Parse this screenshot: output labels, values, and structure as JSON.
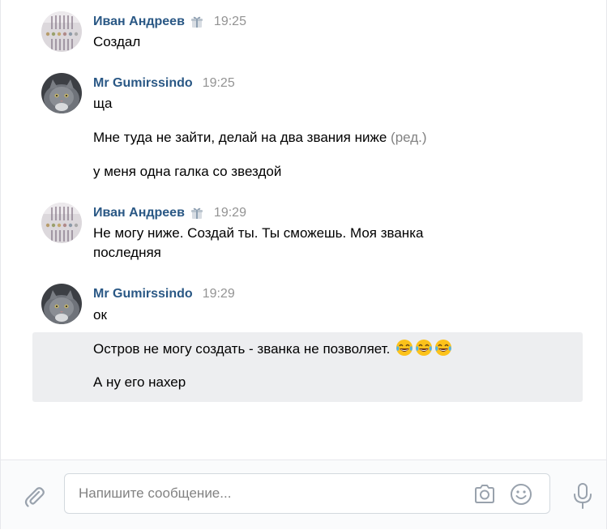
{
  "messages": [
    {
      "author": "Иван Андреев",
      "time": "19:25",
      "lines": [
        "Создал"
      ]
    },
    {
      "author": "Mr Gumirssindo",
      "time": "19:25",
      "lines": [
        "ща",
        "Мне туда не зайти, делай на два звания ниже",
        "у меня одна галка со звездой"
      ],
      "edited_label": "(ред.)"
    },
    {
      "author": "Иван Андреев",
      "time": "19:29",
      "lines": [
        "Не могу ниже. Создай ты. Ты сможешь. Моя званка",
        "последняя"
      ]
    },
    {
      "author": "Mr Gumirssindo",
      "time": "19:29",
      "lines": [
        "ок",
        "Остров не могу создать - званка не позволяет.",
        "А ну его нахер"
      ]
    }
  ],
  "composer": {
    "placeholder": "Напишите сообщение..."
  },
  "icons": {
    "author_badge": "gift-icon",
    "laugh_emoji": "tears-of-joy-emoji",
    "attach": "paperclip-icon",
    "camera": "camera-icon",
    "smile": "smile-icon",
    "mic": "microphone-icon"
  },
  "colors": {
    "author_link": "#2a5885",
    "time": "#939393",
    "highlight_bg": "#edeef0",
    "icon_gray": "#99a2ad"
  }
}
